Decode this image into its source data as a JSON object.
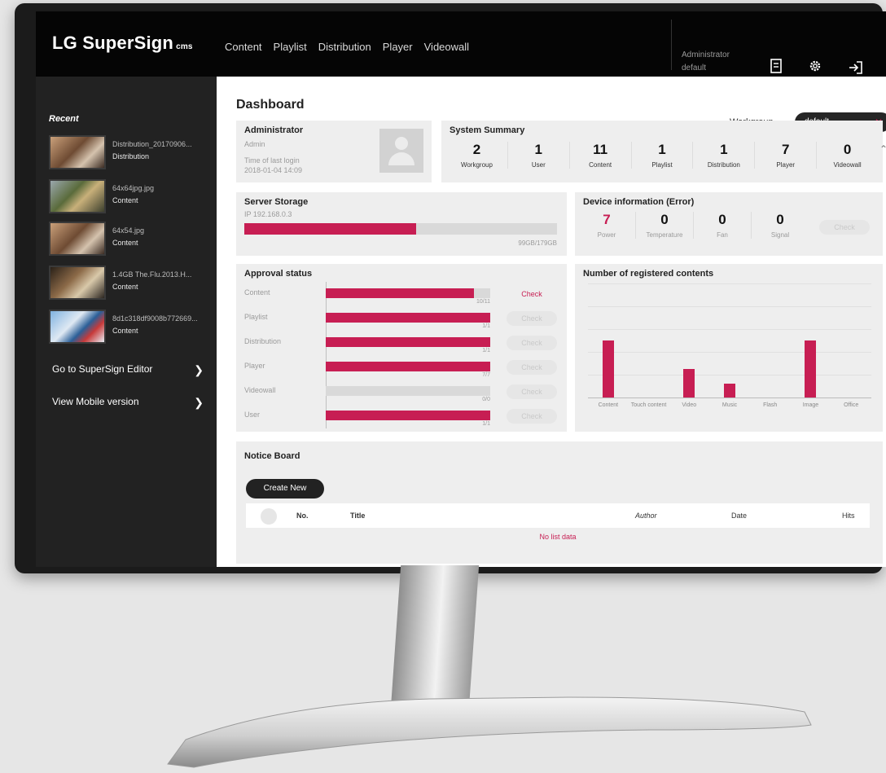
{
  "topbar": {
    "logo": "LG SuperSign",
    "logo_suffix": "cms",
    "nav": [
      "Content",
      "Playlist",
      "Distribution",
      "Player",
      "Videowall"
    ],
    "user_role": "Administrator",
    "user_group": "default"
  },
  "sidebar": {
    "recent_label": "Recent",
    "items": [
      {
        "name": "Distribution_20170906...",
        "type": "Distribution"
      },
      {
        "name": "64x64jpg.jpg",
        "type": "Content"
      },
      {
        "name": "64x54.jpg",
        "type": "Content"
      },
      {
        "name": "1.4GB The.Flu.2013.H...",
        "type": "Content"
      },
      {
        "name": "8d1c318df9008b772669...",
        "type": "Content"
      }
    ],
    "links": [
      "Go to SuperSign Editor",
      "View Mobile version"
    ]
  },
  "main": {
    "title": "Dashboard",
    "workgroup_label": "Workgroup",
    "workgroup_value": "default",
    "admin": {
      "title": "Administrator",
      "role": "Admin",
      "last_login_label": "Time of last login",
      "last_login": "2018-01-04 14:09"
    },
    "summary": {
      "title": "System Summary",
      "items": [
        {
          "value": "2",
          "label": "Workgroup"
        },
        {
          "value": "1",
          "label": "User"
        },
        {
          "value": "11",
          "label": "Content"
        },
        {
          "value": "1",
          "label": "Playlist"
        },
        {
          "value": "1",
          "label": "Distribution"
        },
        {
          "value": "7",
          "label": "Player"
        },
        {
          "value": "0",
          "label": "Videowall"
        }
      ]
    },
    "storage": {
      "title": "Server Storage",
      "ip": "IP 192.168.0.3",
      "used_fraction": 0.55,
      "text": "99GB/179GB"
    },
    "device": {
      "title": "Device information (Error)",
      "items": [
        {
          "value": "7",
          "label": "Power"
        },
        {
          "value": "0",
          "label": "Temperature"
        },
        {
          "value": "0",
          "label": "Fan"
        },
        {
          "value": "0",
          "label": "Signal"
        }
      ],
      "check": "Check"
    },
    "approval": {
      "title": "Approval status",
      "rows": [
        {
          "label": "Content",
          "fraction": 0.9,
          "count": "10/11",
          "check": "Check",
          "active": true
        },
        {
          "label": "Playlist",
          "fraction": 1.0,
          "count": "1/1",
          "check": "Check",
          "active": false
        },
        {
          "label": "Distribution",
          "fraction": 1.0,
          "count": "1/1",
          "check": "Check",
          "active": false
        },
        {
          "label": "Player",
          "fraction": 1.0,
          "count": "7/7",
          "check": "Check",
          "active": false
        },
        {
          "label": "Videowall",
          "fraction": 0.0,
          "count": "0/0",
          "check": "Check",
          "active": false
        },
        {
          "label": "User",
          "fraction": 1.0,
          "count": "1/1",
          "check": "Check",
          "active": false
        }
      ]
    },
    "notice": {
      "title": "Notice Board",
      "create": "Create New",
      "columns": [
        "No.",
        "Title",
        "Author",
        "Date",
        "Hits"
      ],
      "empty": "No list data"
    }
  },
  "chart_data": {
    "type": "bar",
    "title": "Number of registered contents",
    "categories": [
      "Content",
      "Touch content",
      "Video",
      "Music",
      "Flash",
      "Image",
      "Office"
    ],
    "values": [
      5,
      0,
      2.5,
      1.2,
      0,
      5,
      0
    ],
    "ylim": [
      0,
      10
    ],
    "grid": true
  },
  "colors": {
    "accent": "#c71e53",
    "topbar": "#050505",
    "sidebar": "#222222"
  }
}
